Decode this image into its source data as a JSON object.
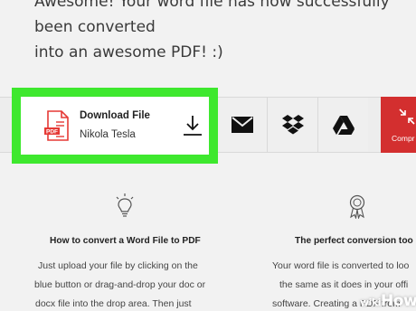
{
  "message": {
    "line1": "Awesome! Your word file has now successfully been converted",
    "line2": "into an awesome PDF! :)"
  },
  "download": {
    "title": "Download File",
    "file_name": "Nikola Tesla",
    "file_icon": "pdf-file-icon",
    "pdf_badge": "PDF",
    "action_icon": "download-icon",
    "highlight_color": "#3ee82e"
  },
  "share": {
    "mail_icon": "mail-icon",
    "dropbox_icon": "dropbox-icon",
    "drive_icon": "google-drive-icon",
    "compress_label": "Compr",
    "compress_color": "#d32f2f"
  },
  "features": {
    "left": {
      "icon": "lightbulb-icon",
      "title": "How to convert a Word File to PDF",
      "lines": [
        "Just upload your file by clicking on the",
        "blue button or drag-and-drop your doc or",
        "docx file into the drop area. Then just"
      ]
    },
    "right": {
      "icon": "award-ribbon-icon",
      "title": "The perfect conversion too",
      "lines": [
        "Your word file is converted to loo",
        "the same as it does in your offi",
        "software. Creating a PDF from"
      ]
    }
  },
  "watermark": {
    "wiki": "wiki",
    "how": "How"
  }
}
